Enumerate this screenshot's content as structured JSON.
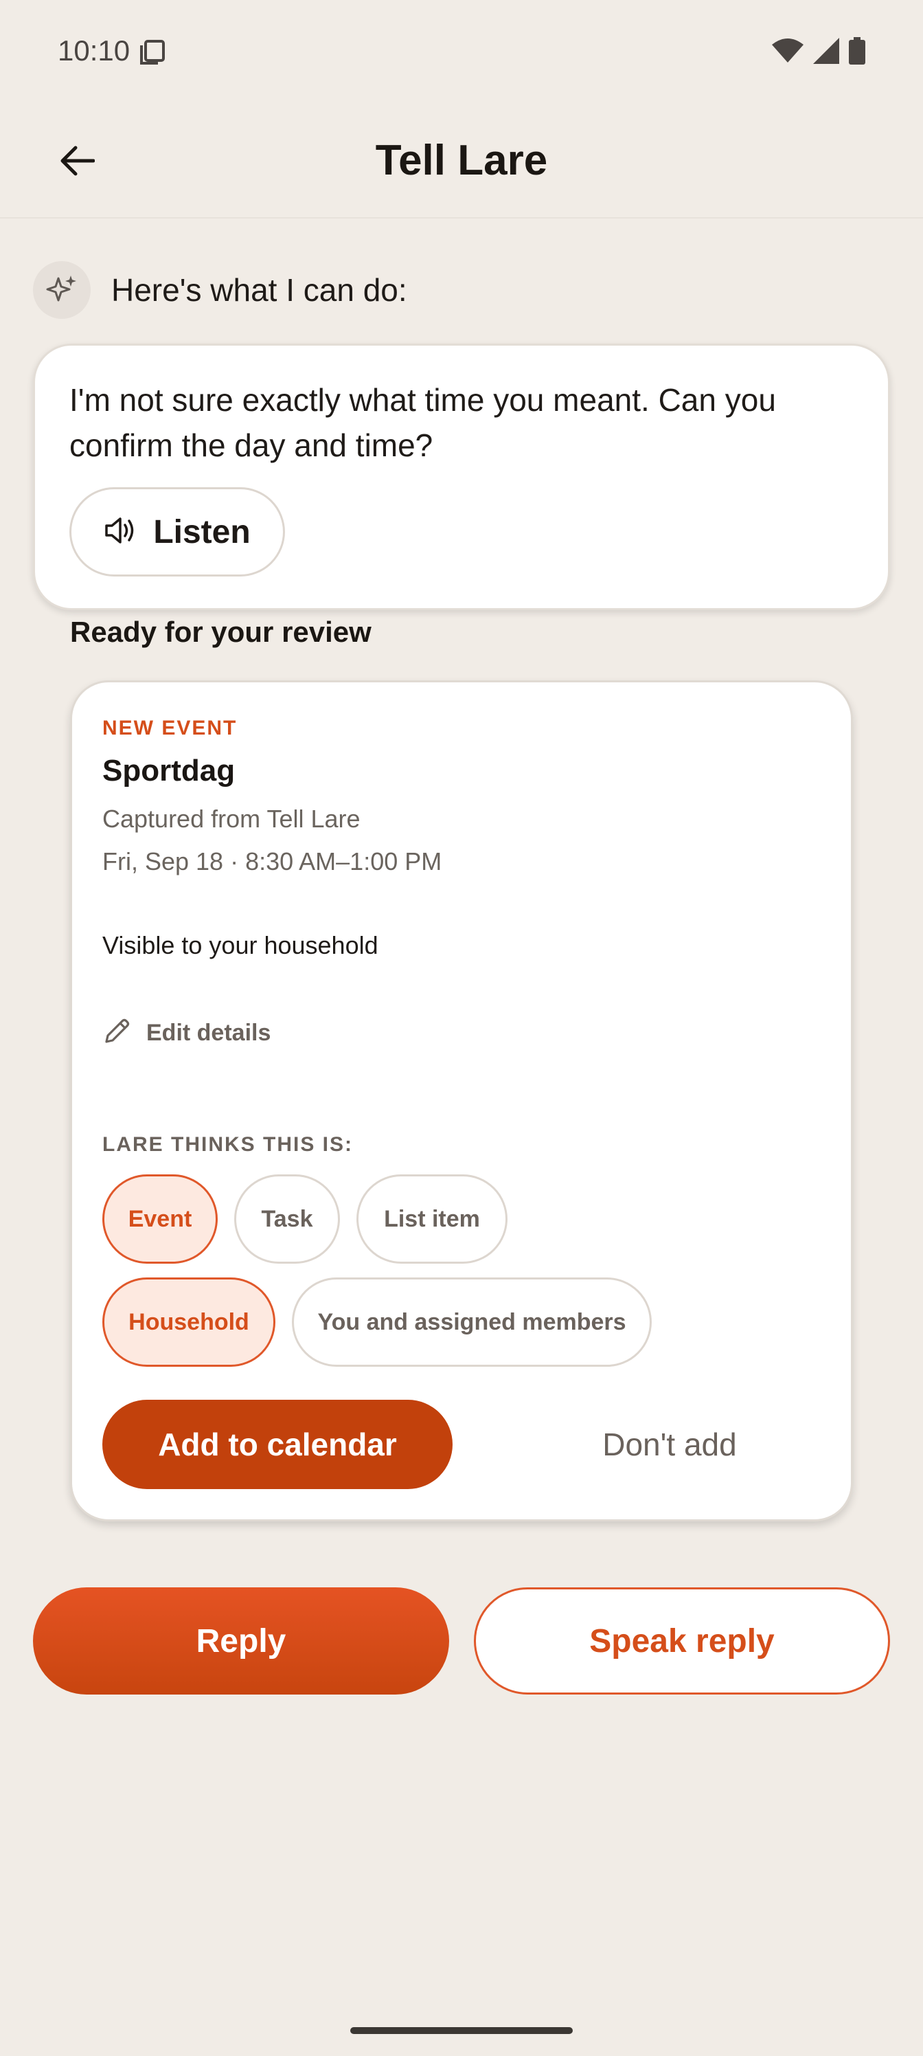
{
  "status_bar": {
    "time": "10:10",
    "icons": [
      "screen-copy-icon",
      "wifi-icon",
      "signal-icon",
      "battery-icon"
    ]
  },
  "app_bar": {
    "back_icon": "arrow-left-icon",
    "title": "Tell Lare"
  },
  "assistant": {
    "icon": "sparkle-icon",
    "intro": "Here's what I can do:",
    "message": "I'm not sure exactly what time you meant. Can you confirm the day and time?",
    "listen_icon": "speaker-icon",
    "listen_label": "Listen"
  },
  "review": {
    "heading": "Ready for your review",
    "kicker": "NEW EVENT",
    "title": "Sportdag",
    "source": "Captured from Tell Lare",
    "when": "Fri, Sep 18 · 8:30 AM–1:00 PM",
    "visibility": "Visible to your household",
    "edit_icon": "pencil-icon",
    "edit_label": "Edit details",
    "classify_heading": "LARE THINKS THIS IS:",
    "type_chips": [
      {
        "label": "Event",
        "selected": true
      },
      {
        "label": "Task",
        "selected": false
      },
      {
        "label": "List item",
        "selected": false
      }
    ],
    "audience_chips": [
      {
        "label": "Household",
        "selected": true
      },
      {
        "label": "You and assigned members",
        "selected": false
      }
    ],
    "add_label": "Add to calendar",
    "dont_add_label": "Don't add"
  },
  "actions": {
    "reply_label": "Reply",
    "speak_reply_label": "Speak reply"
  },
  "colors": {
    "background": "#f1ece6",
    "accent": "#d54e1a",
    "accent_dark": "#c2410c",
    "chip_selected_bg": "#fde9e0",
    "muted_text": "#6a625c"
  }
}
